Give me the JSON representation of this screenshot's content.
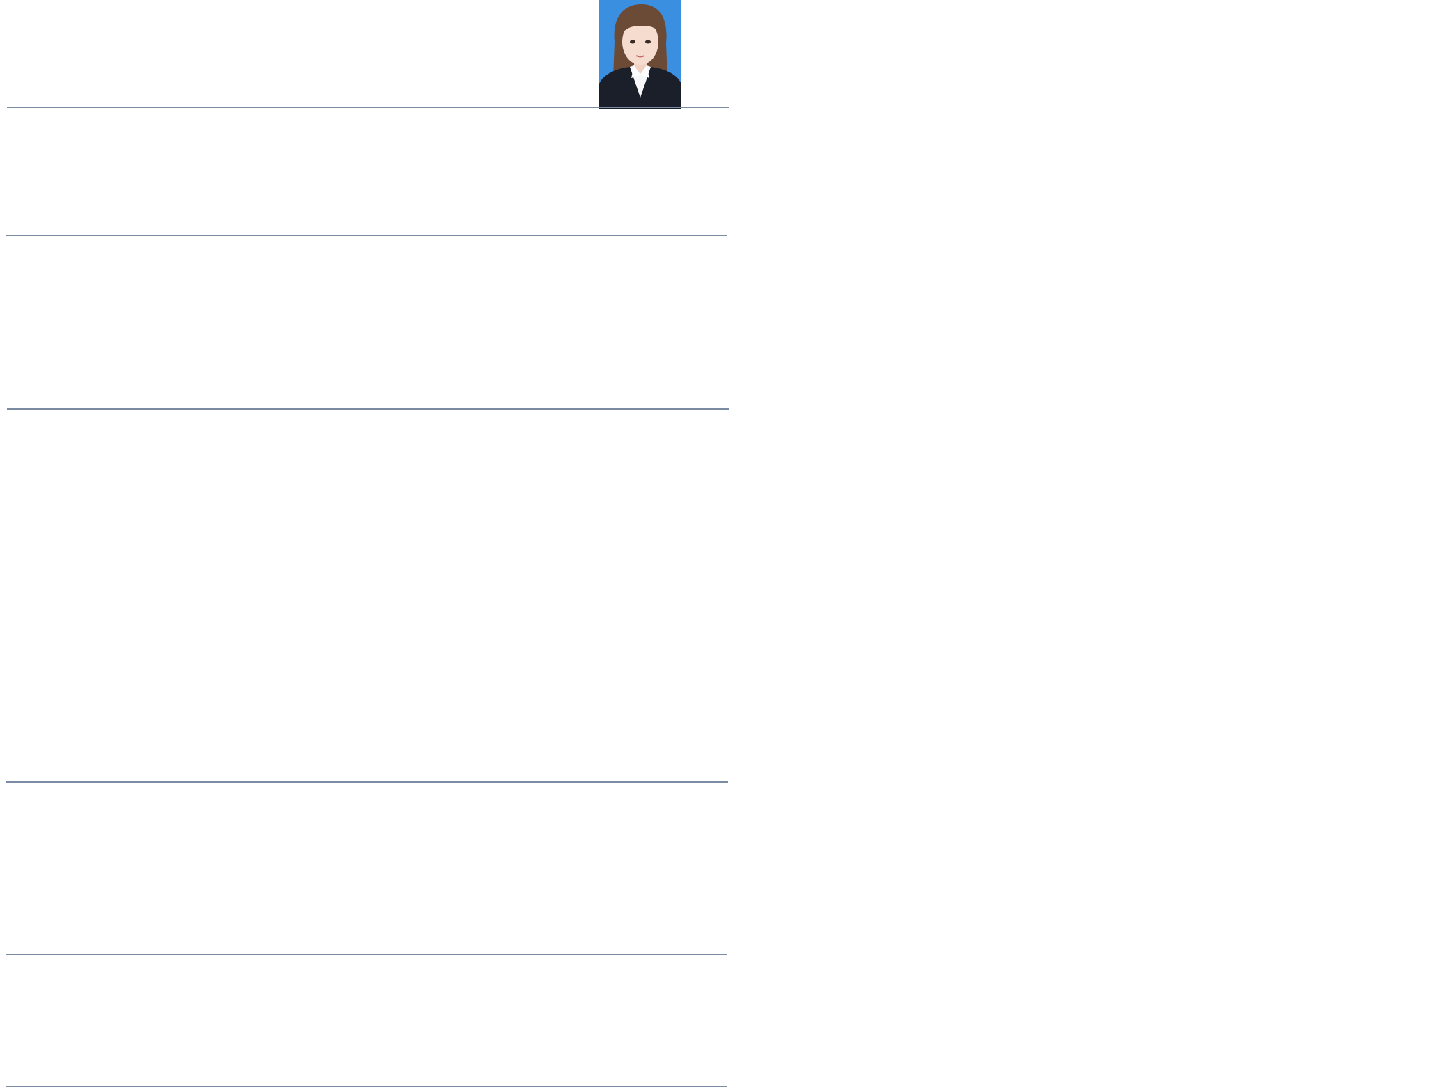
{
  "document": {
    "type": "resume-template",
    "accent_color": "#7a8ba3",
    "photo_background_color": "#3b8fe0",
    "sections_count": 5
  }
}
